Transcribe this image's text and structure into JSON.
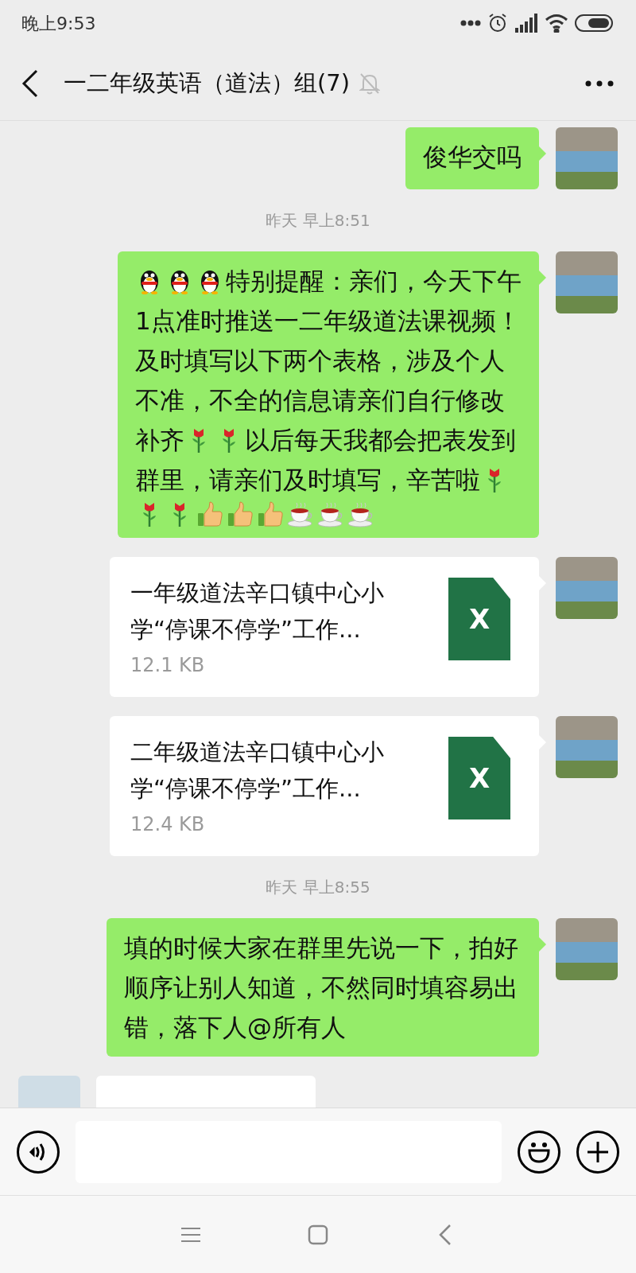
{
  "status_bar": {
    "time": "晚上9:53"
  },
  "header": {
    "title": "一二年级英语（道法）组(7)",
    "muted": true
  },
  "messages": [
    {
      "kind": "text",
      "outgoing": true,
      "lines": [
        [
          {
            "kind": "text",
            "text": "俊华交吗"
          }
        ]
      ]
    },
    {
      "kind": "time",
      "text": "昨天 早上8:51"
    },
    {
      "kind": "text",
      "outgoing": true,
      "lines": [
        [
          {
            "kind": "penguin"
          },
          {
            "kind": "penguin"
          },
          {
            "kind": "penguin"
          },
          {
            "kind": "text",
            "text": "特别提醒：亲们，今天下午"
          }
        ],
        [
          {
            "kind": "text",
            "text": "1点准时推送一二年级道法课视频！"
          }
        ],
        [
          {
            "kind": "text",
            "text": "及时填写以下两个表格，涉及个人"
          }
        ],
        [
          {
            "kind": "text",
            "text": "不准，不全的信息请亲们自行修改"
          }
        ],
        [
          {
            "kind": "text",
            "text": "补齐"
          },
          {
            "kind": "rose"
          },
          {
            "kind": "rose"
          },
          {
            "kind": "text",
            "text": "以后每天我都会把表发到"
          }
        ],
        [
          {
            "kind": "text",
            "text": "群里，请亲们及时填写，辛苦啦"
          },
          {
            "kind": "rose"
          }
        ],
        [
          {
            "kind": "rose"
          },
          {
            "kind": "rose"
          },
          {
            "kind": "thumbs-up"
          },
          {
            "kind": "thumbs-up"
          },
          {
            "kind": "thumbs-up"
          },
          {
            "kind": "tea"
          },
          {
            "kind": "tea"
          },
          {
            "kind": "tea"
          }
        ]
      ]
    },
    {
      "kind": "file",
      "outgoing": true,
      "name": "一年级道法辛口镇中心小学“停课不停学”工作...",
      "size": "12.1 KB",
      "icon_letter": "X"
    },
    {
      "kind": "file",
      "outgoing": true,
      "name": "二年级道法辛口镇中心小学“停课不停学”工作...",
      "size": "12.4 KB",
      "icon_letter": "X"
    },
    {
      "kind": "time",
      "text": "昨天 早上8:55"
    },
    {
      "kind": "text",
      "outgoing": true,
      "lines": [
        [
          {
            "kind": "text",
            "text": "填的时候大家在群里先说一下，拍好顺序让别人知道，不然同时填容易出错，落下人@所有人"
          }
        ]
      ]
    },
    {
      "kind": "partial",
      "outgoing": false
    }
  ]
}
